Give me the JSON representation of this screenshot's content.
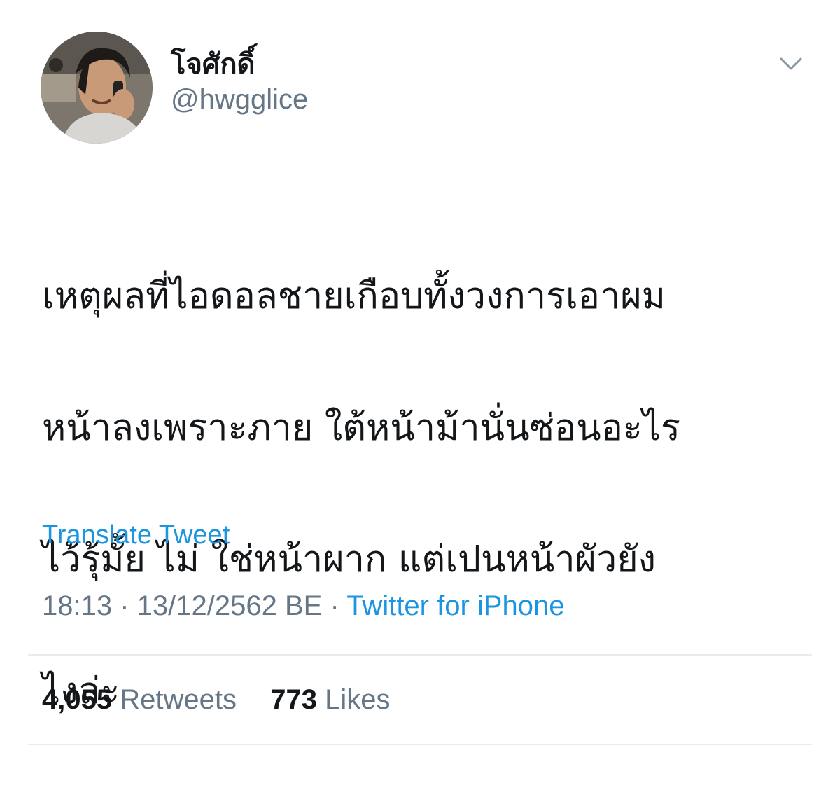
{
  "tweet": {
    "author": {
      "display_name": "โจศักดิ์",
      "handle": "@hwgglice"
    },
    "menu_icon": "chevron-down-icon",
    "text_lines": [
      "เหตุผลที่ไอดอลชายเกือบทั้งวงการเอาผม",
      "หน้าลงเพราะภาย ใต้หน้าม้านั่นซ่อนอะไร",
      "ไว้รุ้มั้ย ไม่ ใช่หน้าผาก แต่เปนหน้าผัวยัง",
      "ไงล่ะ"
    ],
    "translate_label": "Translate Tweet",
    "time": "18:13",
    "date": "13/12/2562 BE",
    "separator": "·",
    "source": "Twitter for iPhone",
    "retweets": {
      "count": "4,055",
      "label": "Retweets"
    },
    "likes": {
      "count": "773",
      "label": "Likes"
    }
  },
  "colors": {
    "link": "#1b95e0",
    "secondary_text": "#657786",
    "primary_text": "#14171a",
    "divider": "#e6ecf0"
  }
}
